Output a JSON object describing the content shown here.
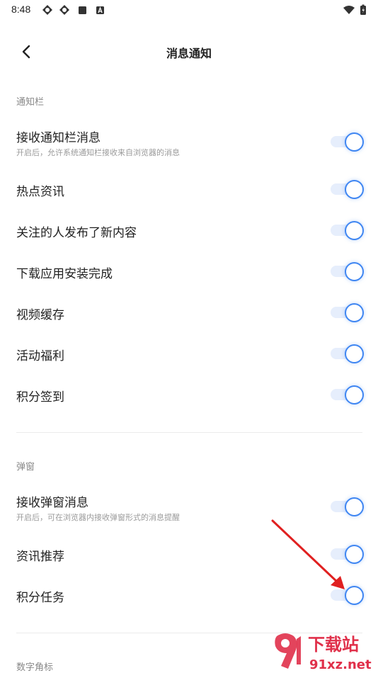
{
  "status_bar": {
    "time": "8:48",
    "icons": [
      "app-icon",
      "app-icon",
      "square-icon",
      "a-badge-icon",
      "wifi-icon",
      "battery-charging-icon"
    ]
  },
  "header": {
    "title": "消息通知",
    "back_icon": "back-arrow-icon"
  },
  "sections": [
    {
      "label": "通知栏",
      "items": [
        {
          "label": "接收通知栏消息",
          "sub": "开启后，允许系统通知栏接收来自浏览器的消息",
          "enabled": true
        },
        {
          "label": "热点资讯",
          "enabled": true
        },
        {
          "label": "关注的人发布了新内容",
          "enabled": true
        },
        {
          "label": "下载应用安装完成",
          "enabled": true
        },
        {
          "label": "视频缓存",
          "enabled": true
        },
        {
          "label": "活动福利",
          "enabled": true
        },
        {
          "label": "积分签到",
          "enabled": true
        }
      ]
    },
    {
      "label": "弹窗",
      "items": [
        {
          "label": "接收弹窗消息",
          "sub": "开启后，可在浏览器内接收弹窗形式的消息提醒",
          "enabled": true
        },
        {
          "label": "资讯推荐",
          "enabled": true
        },
        {
          "label": "积分任务",
          "enabled": true
        }
      ]
    },
    {
      "label": "数字角标",
      "items": []
    }
  ],
  "watermark": {
    "brand": "下载站",
    "url": "91xz.net"
  },
  "colors": {
    "accent": "#3f86f2",
    "track": "#e6eefc",
    "annotation_arrow": "#e02020",
    "watermark": "#e0304a"
  }
}
